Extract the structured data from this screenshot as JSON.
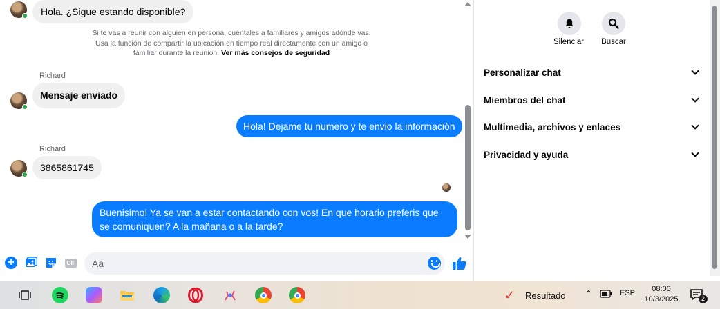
{
  "chat": {
    "messages": [
      {
        "text": "Hola. ¿Sigue estando disponible?"
      },
      {
        "text": "Mensaje enviado"
      },
      {
        "text": "Hola! Dejame tu numero y te envio la información"
      },
      {
        "text": "3865861745"
      },
      {
        "text": "Buenisimo! Ya se van a estar contactando con vos! En que horario preferis que se comuniquen? A la mañana o a la tarde?"
      }
    ],
    "sender_names": [
      "Richard",
      "Richard"
    ],
    "safety_notice": "Si te vas a reunir con alguien en persona, cuéntales a familiares y amigos adónde vas. Usa la función de compartir la ubicación en tiempo real directamente con un amigo o familiar durante la reunión.",
    "safety_link": "Ver más consejos de seguridad"
  },
  "composer": {
    "placeholder": "Aa",
    "gif_label": "GIF"
  },
  "details": {
    "actions": [
      {
        "label": "Silenciar",
        "icon": "bell-icon"
      },
      {
        "label": "Buscar",
        "icon": "search-icon"
      }
    ],
    "sections": [
      {
        "label": "Personalizar chat"
      },
      {
        "label": "Miembros del chat"
      },
      {
        "label": "Multimedia, archivos y enlaces"
      },
      {
        "label": "Privacidad y ayuda"
      }
    ]
  },
  "taskbar": {
    "apps": [
      "task-view-icon",
      "spotify-icon",
      "copilot-icon",
      "file-explorer-icon",
      "edge-icon",
      "opera-icon",
      "app-icon",
      "chrome-icon",
      "chrome-icon"
    ],
    "result_label": "Resultado",
    "language": "ESP",
    "time": "08:00",
    "date": "10/3/2025",
    "notification_count": "2"
  },
  "colors": {
    "outgoing_bubble": "#0a7cff",
    "incoming_bubble": "#f0f0f0",
    "accent": "#0a7cff"
  }
}
